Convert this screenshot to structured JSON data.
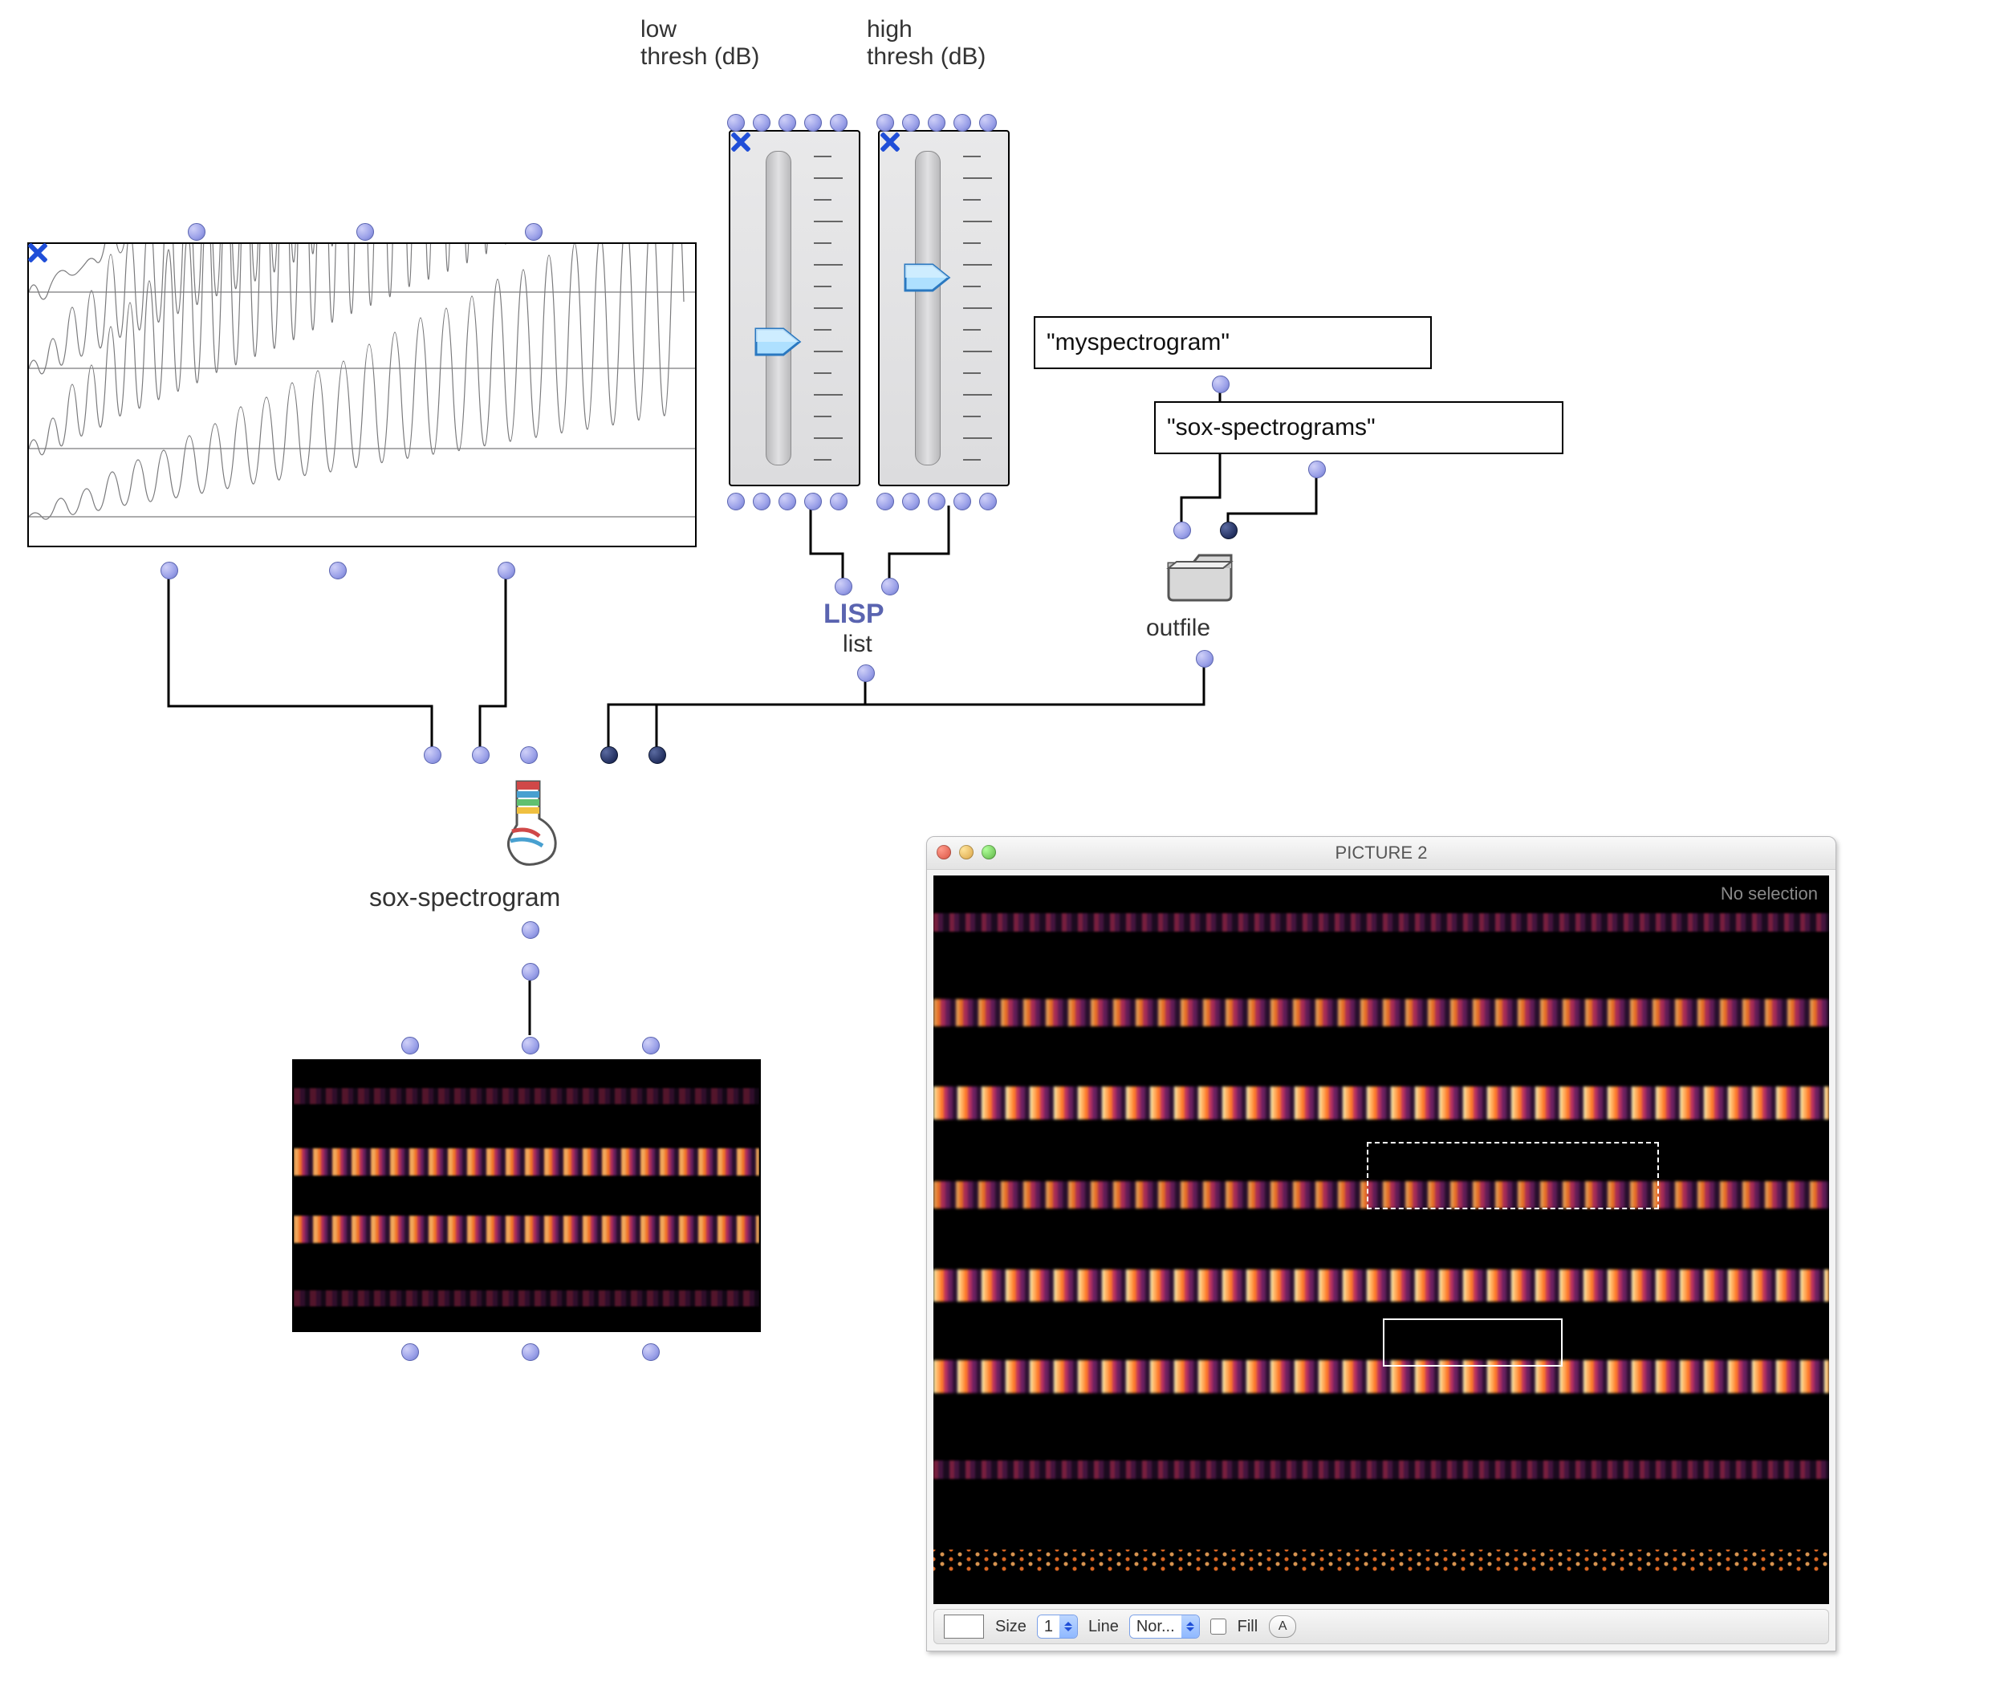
{
  "labels": {
    "low_thresh": "low\nthresh (dB)",
    "high_thresh": "high\nthresh (dB)",
    "lisp": "LISP",
    "list": "list",
    "outfile": "outfile",
    "sox_spectrogram": "sox-spectrogram"
  },
  "strings": {
    "myspectrogram": "\"myspectrogram\"",
    "sox_spectrograms": "\"sox-spectrograms\""
  },
  "picture_window": {
    "title": "PICTURE 2",
    "no_selection": "No selection",
    "toolbar": {
      "size_label": "Size",
      "size_value": "1",
      "line_label": "Line",
      "line_value": "Nor...",
      "fill_label": "Fill",
      "a_button": "A"
    }
  },
  "colors": {
    "port": "#9aa0e8",
    "wire": "#000000",
    "thumb": "#6fb8ff"
  }
}
